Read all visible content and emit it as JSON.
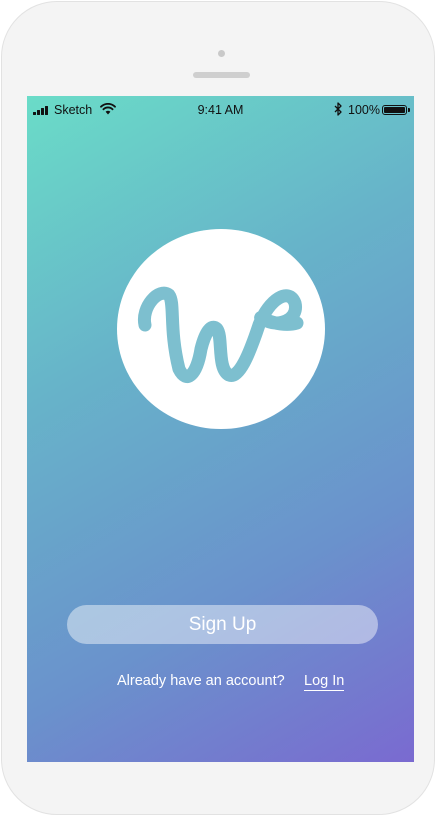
{
  "status_bar": {
    "carrier": "Sketch",
    "time": "9:41 AM",
    "battery_percent": "100%",
    "battery_level": 1.0,
    "icons": [
      "signal-icon",
      "wifi-icon",
      "bluetooth-icon",
      "battery-icon"
    ]
  },
  "logo": {
    "icon": "w-logo-icon",
    "color": "#7dbfcf"
  },
  "actions": {
    "signup_label": "Sign Up",
    "account_prompt": "Already have an account?",
    "login_label": "Log In"
  },
  "colors": {
    "gradient_start": "#6adcc8",
    "gradient_end": "#7a6ad0",
    "button_fill": "rgba(255,255,255,0.45)",
    "text": "#ffffff"
  }
}
